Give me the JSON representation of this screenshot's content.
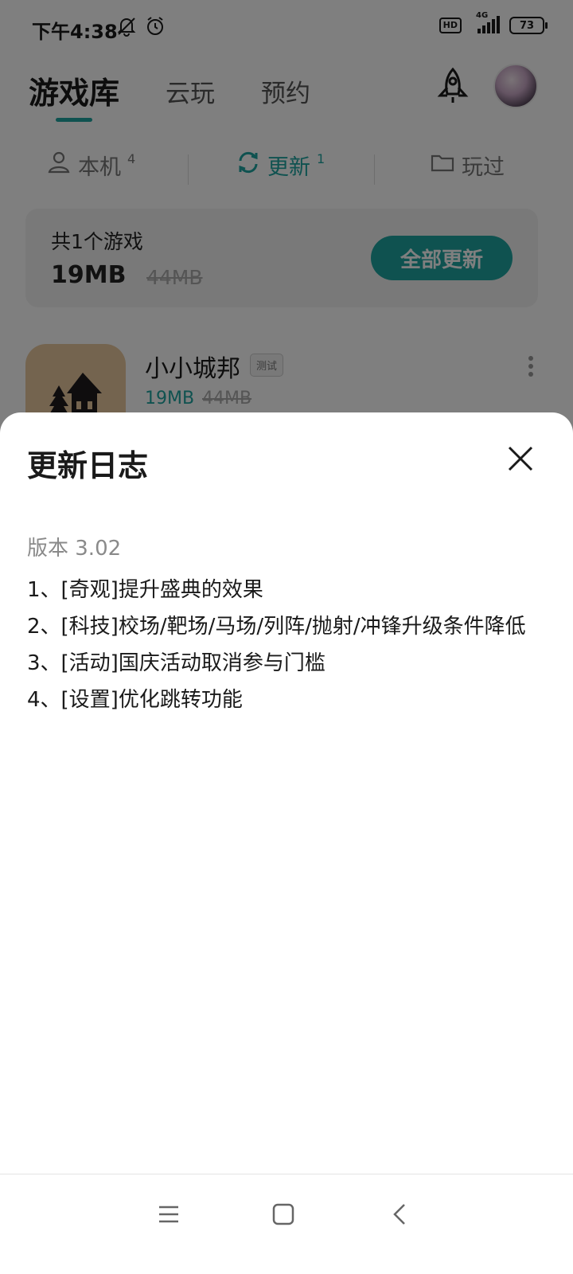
{
  "status_bar": {
    "time": "下午4:38",
    "hd": "HD",
    "network": "4G",
    "battery": "73"
  },
  "header": {
    "tabs": [
      {
        "label": "游戏库",
        "active": true
      },
      {
        "label": "云玩",
        "active": false
      },
      {
        "label": "预约",
        "active": false
      }
    ]
  },
  "sub_tabs": [
    {
      "label": "本机",
      "count": "4"
    },
    {
      "label": "更新",
      "count": "1"
    },
    {
      "label": "玩过",
      "count": ""
    }
  ],
  "summary": {
    "title": "共1个游戏",
    "size": "19MB",
    "original_size": "44MB",
    "button_label": "全部更新"
  },
  "game": {
    "name": "小小城邦",
    "tag": "测试",
    "size": "19MB",
    "original_size": "44MB"
  },
  "sheet": {
    "title": "更新日志",
    "version": "版本 3.02",
    "notes": [
      "1、[奇观]提升盛典的效果",
      "2、[科技]校场/靶场/马场/列阵/抛射/冲锋升级条件降低",
      "3、[活动]国庆活动取消参与门槛",
      "4、[设置]优化跳转功能"
    ]
  },
  "colors": {
    "accent": "#1fa4a0",
    "overlay": "rgba(0,0,0,0.5)"
  },
  "icons": [
    "mute-bell-icon",
    "alarm-icon",
    "signal-icon",
    "battery-icon",
    "rocket-icon",
    "user-icon",
    "refresh-icon",
    "folder-icon",
    "more-icon",
    "close-icon",
    "menu-nav-icon",
    "home-nav-icon",
    "back-nav-icon"
  ]
}
